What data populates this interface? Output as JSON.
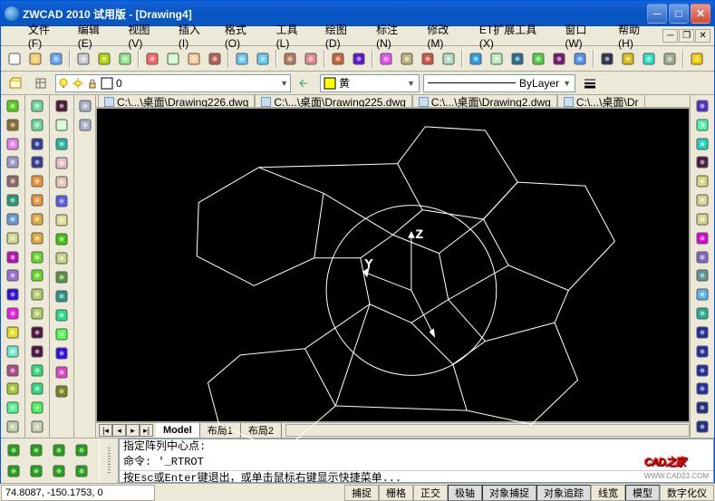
{
  "window": {
    "title": "ZWCAD 2010 试用版 - [Drawing4]"
  },
  "menus": [
    {
      "label": "文件(F)",
      "key": "file"
    },
    {
      "label": "编辑(E)",
      "key": "edit"
    },
    {
      "label": "视图(V)",
      "key": "view"
    },
    {
      "label": "插入(I)",
      "key": "insert"
    },
    {
      "label": "格式(O)",
      "key": "format"
    },
    {
      "label": "工具(L)",
      "key": "tools"
    },
    {
      "label": "绘图(D)",
      "key": "draw"
    },
    {
      "label": "标注(N)",
      "key": "dim"
    },
    {
      "label": "修改(M)",
      "key": "modify"
    },
    {
      "label": "ET扩展工具(X)",
      "key": "et"
    },
    {
      "label": "窗口(W)",
      "key": "window"
    },
    {
      "label": "帮助(H)",
      "key": "help"
    }
  ],
  "layerbox": {
    "current_layer": "0"
  },
  "color_combo": {
    "label": "黄"
  },
  "linetype_combo": {
    "label": "ByLayer"
  },
  "doc_tabs": [
    {
      "label": "C:\\...\\桌面\\Drawing226.dwg"
    },
    {
      "label": "C:\\...\\桌面\\Drawing225.dwg"
    },
    {
      "label": "C:\\...\\桌面\\Drawing2.dwg"
    },
    {
      "label": "C:\\...\\桌面\\Dr"
    }
  ],
  "layout_tabs": [
    {
      "label": "Model",
      "active": true
    },
    {
      "label": "布局1",
      "active": false
    },
    {
      "label": "布局2",
      "active": false
    }
  ],
  "command": {
    "line1": "指定阵列中心点:",
    "line2": "命令: '_RTROT",
    "line3": "按Esc或Enter键退出，或单击鼠标右键显示快捷菜单..."
  },
  "status": {
    "coords": "74.8087, -150.1753, 0",
    "toggles": [
      {
        "label": "捕捉",
        "on": false
      },
      {
        "label": "栅格",
        "on": false
      },
      {
        "label": "正交",
        "on": false
      },
      {
        "label": "极轴",
        "on": true
      },
      {
        "label": "对象捕捉",
        "on": true
      },
      {
        "label": "对象追踪",
        "on": true
      },
      {
        "label": "线宽",
        "on": false
      },
      {
        "label": "模型",
        "on": true
      },
      {
        "label": "数字化仪",
        "on": false
      }
    ]
  },
  "axes": {
    "z": "Z",
    "y": "Y"
  },
  "watermark": {
    "main": "CAD之家",
    "sub": "WWW.CAD23.COM"
  },
  "toolbar_icons": [
    "new",
    "open",
    "save",
    "sep",
    "print",
    "preview",
    "publish",
    "sep",
    "cut",
    "copy",
    "paste",
    "match",
    "sep",
    "undo",
    "redo",
    "sep",
    "rt-pan",
    "rt-zoom",
    "sep",
    "zoom-win",
    "zoom-prev",
    "sep",
    "props",
    "design-center",
    "tool-palette",
    "app-center",
    "sep",
    "box",
    "sphere",
    "cylinder",
    "cone",
    "wedge",
    "torus",
    "sep",
    "vp-single",
    "vp-poly",
    "ucs",
    "render",
    "sep",
    "help"
  ],
  "left_icons_a": [
    "line",
    "xline",
    "pline",
    "polygon",
    "rectangle",
    "arc",
    "circle",
    "revcloud",
    "spline",
    "ellipse",
    "ellipse-arc",
    "block",
    "point",
    "hatch",
    "gradient",
    "region",
    "table",
    "mtext"
  ],
  "left_icons_b": [
    "sphere-a",
    "sphere-b",
    "cyl-a",
    "cyl-b",
    "box-a",
    "box-b",
    "cone-a",
    "cone-b",
    "wedge-a",
    "wedge-b",
    "torus-a",
    "torus-b",
    "ext-a",
    "ext-b",
    "rev-a",
    "rev-b",
    "slice",
    "section"
  ],
  "left_icons_c": [
    "erase",
    "copy",
    "mirror",
    "offset",
    "array",
    "move",
    "rotate",
    "scale",
    "stretch",
    "trim",
    "extend",
    "break",
    "join",
    "chamfer",
    "fillet",
    "explode"
  ],
  "left_icons_d": [
    "layer1",
    "layer2"
  ],
  "right_icons": [
    "dist",
    "area",
    "pan",
    "zoom-rt",
    "zoom-w",
    "zoom-e",
    "zoom-p",
    "orbit",
    "3dorbit",
    "swivel",
    "walk",
    "fly",
    "v1",
    "v2",
    "v3",
    "v4",
    "m1",
    "m2"
  ],
  "cmd_side_icons": [
    "a",
    "b",
    "c",
    "d",
    "e",
    "f",
    "g",
    "h"
  ]
}
